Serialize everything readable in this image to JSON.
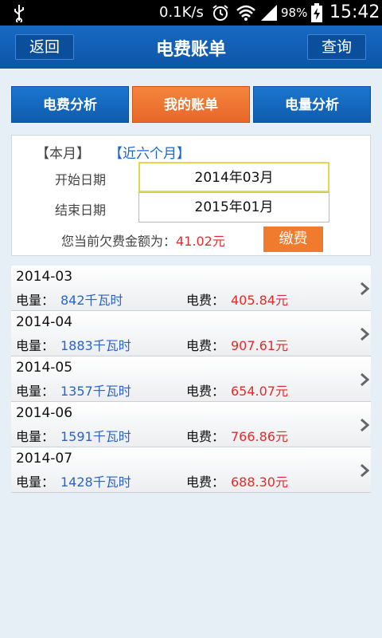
{
  "status": {
    "speed": "0.1K/s",
    "battery_pct": "98%",
    "time": "15:42"
  },
  "header": {
    "back_label": "返回",
    "title": "电费账单",
    "query_label": "查询"
  },
  "tabs": [
    {
      "label": "电费分析"
    },
    {
      "label": "我的账单"
    },
    {
      "label": "电量分析"
    }
  ],
  "filter": {
    "current_month": "【本月】",
    "six_months": "【近六个月】",
    "start_label": "开始日期",
    "start_value": "2014年03月",
    "end_label": "结束日期",
    "end_value": "2015年01月",
    "debt_label": "您当前欠费金额为：",
    "debt_amount": "41.02元",
    "pay_label": "缴费"
  },
  "bills": [
    {
      "month": "2014-03",
      "usage_label": "电量：",
      "usage": "842千瓦时",
      "fee_label": "电费：",
      "fee": "405.84元"
    },
    {
      "month": "2014-04",
      "usage_label": "电量：",
      "usage": "1883千瓦时",
      "fee_label": "电费：",
      "fee": "907.61元"
    },
    {
      "month": "2014-05",
      "usage_label": "电量：",
      "usage": "1357千瓦时",
      "fee_label": "电费：",
      "fee": "654.07元"
    },
    {
      "month": "2014-06",
      "usage_label": "电量：",
      "usage": "1591千瓦时",
      "fee_label": "电费：",
      "fee": "766.86元"
    },
    {
      "month": "2014-07",
      "usage_label": "电量：",
      "usage": "1428千瓦时",
      "fee_label": "电费：",
      "fee": "688.30元"
    }
  ]
}
